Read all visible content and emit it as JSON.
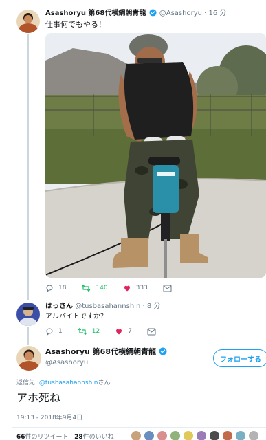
{
  "tweet1": {
    "display_name": "Asashoryu 第68代横綱朝青龍",
    "handle": "@Asashoryu",
    "separator": "·",
    "time": "16 分",
    "text": "仕事何でもやる！",
    "replies": "18",
    "retweets": "140",
    "likes": "333"
  },
  "tweet2": {
    "display_name": "はっさん",
    "handle": "@tusbasahannshin",
    "separator": "·",
    "time": "8 分",
    "text": "アルバイトですか？",
    "replies": "1",
    "retweets": "12",
    "likes": "7"
  },
  "main_tweet": {
    "display_name": "Asashoryu 第68代横綱朝青龍",
    "handle": "@Asashoryu",
    "follow_label": "フォローする",
    "reply_prefix": "返信先: ",
    "reply_handle": "@tusbasahannshin",
    "reply_suffix": "さん",
    "text": "アホ死ね",
    "timestamp": "19:13 - 2018年9月4日",
    "retweet_count": "66",
    "retweet_label": "件のリツイート",
    "like_count": "28",
    "like_label": "件のいいね"
  },
  "colors": {
    "verified": "#1da1f2",
    "retweet": "#17bf63",
    "like": "#e0245e",
    "link": "#1da1f2",
    "muted": "#657786"
  },
  "icons": [
    "reply-icon",
    "retweet-icon",
    "heart-icon",
    "message-icon",
    "verified-badge-icon"
  ]
}
